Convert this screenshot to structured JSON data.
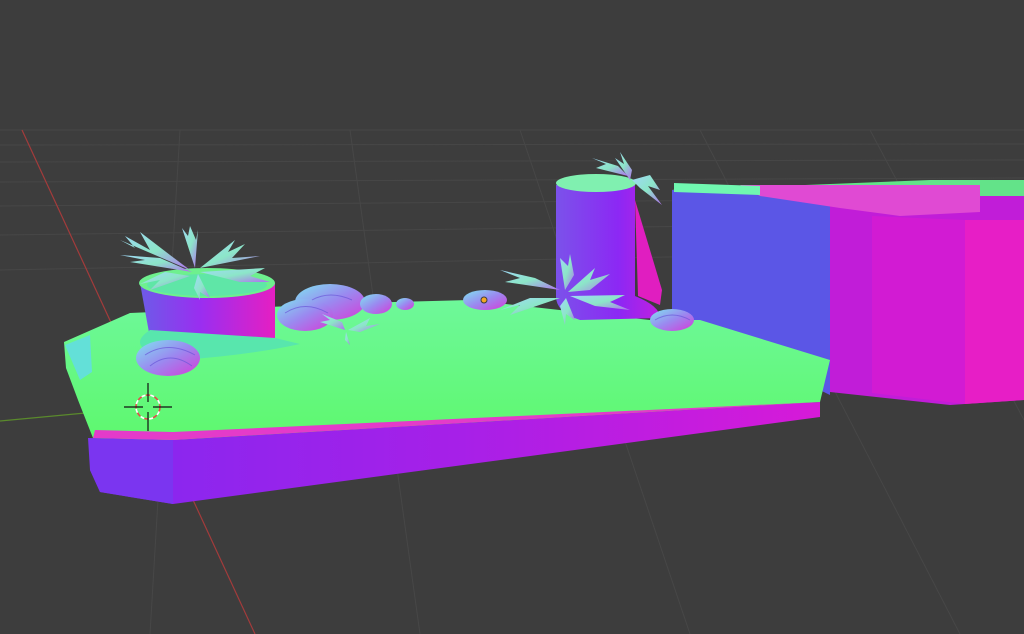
{
  "app": {
    "view": "3D Viewport",
    "shading": "normal-map"
  },
  "colors": {
    "background": "#3d3d3d",
    "grid_line": "#4a4a4a",
    "axis_x": "#a33b3b",
    "axis_y": "#5a8a2c",
    "top_green": "#6cfb86",
    "side_magenta": "#b21ae8",
    "side_violet": "#7a3cf0",
    "side_blue": "#5b56e6",
    "pink": "#e020c8",
    "cursor_red": "#e54b4b"
  },
  "icons": {
    "cursor": "3d-cursor-icon",
    "origin": "object-origin-icon"
  }
}
